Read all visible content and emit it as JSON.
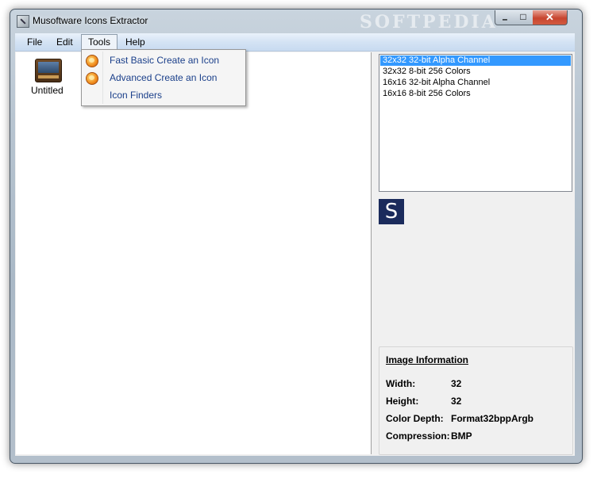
{
  "window": {
    "title": "Musoftware Icons Extractor",
    "watermark": "SOFTPEDIA",
    "controls": {
      "minimize": "–",
      "maximize": "□",
      "close": "✕"
    }
  },
  "menubar": {
    "items": [
      {
        "label": "File"
      },
      {
        "label": "Edit"
      },
      {
        "label": "Tools"
      },
      {
        "label": "Help"
      }
    ]
  },
  "tools_menu": {
    "items": [
      {
        "label": "Fast Basic Create an Icon",
        "icon": "create-icon"
      },
      {
        "label": "Advanced Create an Icon",
        "icon": "create-icon"
      },
      {
        "label": "Icon Finders",
        "icon": ""
      }
    ]
  },
  "file_list": {
    "items": [
      {
        "label": "Untitled",
        "icon": "file-icon"
      }
    ]
  },
  "formats": {
    "selected_index": 0,
    "items": [
      "32x32 32-bit Alpha Channel",
      "32x32 8-bit 256 Colors",
      "16x16 32-bit Alpha Channel",
      "16x16 8-bit 256 Colors"
    ]
  },
  "preview": {
    "glyph": "S",
    "icon": "softpedia-s-icon"
  },
  "image_info": {
    "title": "Image Information",
    "rows": [
      {
        "key": "Width:",
        "value": "32"
      },
      {
        "key": "Height:",
        "value": "32"
      },
      {
        "key": "Color Depth:",
        "value": "Format32bppArgb"
      },
      {
        "key": "Compression:",
        "value": "BMP"
      }
    ]
  },
  "colors": {
    "selection": "#3399ff",
    "menu_text": "#1a3f8a",
    "preview_bg": "#1b2b5c"
  }
}
